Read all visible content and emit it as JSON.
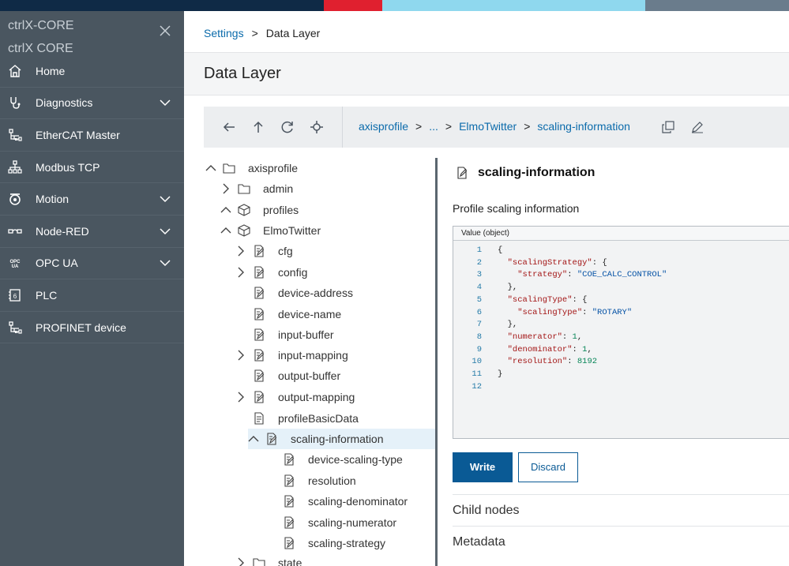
{
  "topbar": {
    "colors": [
      "#0f2a46",
      "#e0202f",
      "#8fd8ee",
      "#6a7c8c"
    ]
  },
  "sidebar": {
    "brand_line1": "ctrlX-CORE",
    "brand_line2": "ctrlX CORE",
    "items": [
      {
        "label": "Home",
        "icon": "home-icon",
        "has_chevron": false
      },
      {
        "label": "Diagnostics",
        "icon": "diagnostics-icon",
        "has_chevron": true
      },
      {
        "label": "EtherCAT Master",
        "icon": "network-icon",
        "has_chevron": false
      },
      {
        "label": "Modbus TCP",
        "icon": "sitemap-icon",
        "has_chevron": false
      },
      {
        "label": "Motion",
        "icon": "motion-icon",
        "has_chevron": true
      },
      {
        "label": "Node-RED",
        "icon": "node-red-icon",
        "has_chevron": true
      },
      {
        "label": "OPC UA",
        "icon": "opc-ua-icon",
        "has_chevron": true
      },
      {
        "label": "PLC",
        "icon": "plc-icon",
        "has_chevron": false
      },
      {
        "label": "PROFINET device",
        "icon": "network-icon",
        "has_chevron": false
      }
    ]
  },
  "breadcrumb": {
    "parent": "Settings",
    "sep": ">",
    "current": "Data Layer"
  },
  "page_title": "Data Layer",
  "path": {
    "root": "axisprofile",
    "ellipsis": "...",
    "parent": "ElmoTwitter",
    "current": "scaling-information",
    "sep": ">"
  },
  "tree": [
    {
      "label": "axisprofile",
      "depth": 0,
      "chevron": "up",
      "icon": "folder-icon"
    },
    {
      "label": "admin",
      "depth": 1,
      "chevron": "right",
      "icon": "folder-icon"
    },
    {
      "label": "profiles",
      "depth": 1,
      "chevron": "up",
      "icon": "cube-icon"
    },
    {
      "label": "ElmoTwitter",
      "depth": 2,
      "chevron": "up",
      "icon": "cube-icon"
    },
    {
      "label": "cfg",
      "depth": 3,
      "chevron": "right",
      "icon": "edit-doc-icon"
    },
    {
      "label": "config",
      "depth": 3,
      "chevron": "right",
      "icon": "edit-doc-icon"
    },
    {
      "label": "device-address",
      "depth": 3,
      "chevron": "",
      "icon": "edit-doc-icon"
    },
    {
      "label": "device-name",
      "depth": 3,
      "chevron": "",
      "icon": "edit-doc-icon"
    },
    {
      "label": "input-buffer",
      "depth": 3,
      "chevron": "",
      "icon": "edit-doc-icon"
    },
    {
      "label": "input-mapping",
      "depth": 3,
      "chevron": "right",
      "icon": "edit-doc-icon"
    },
    {
      "label": "output-buffer",
      "depth": 3,
      "chevron": "",
      "icon": "edit-doc-icon"
    },
    {
      "label": "output-mapping",
      "depth": 3,
      "chevron": "right",
      "icon": "edit-doc-icon"
    },
    {
      "label": "profileBasicData",
      "depth": 3,
      "chevron": "",
      "icon": "doc-icon"
    },
    {
      "label": "scaling-information",
      "depth": 3,
      "chevron": "up",
      "icon": "edit-doc-icon",
      "selected": true
    },
    {
      "label": "device-scaling-type",
      "depth": 4,
      "chevron": "",
      "icon": "edit-doc-icon"
    },
    {
      "label": "resolution",
      "depth": 4,
      "chevron": "",
      "icon": "edit-doc-icon"
    },
    {
      "label": "scaling-denominator",
      "depth": 4,
      "chevron": "",
      "icon": "edit-doc-icon"
    },
    {
      "label": "scaling-numerator",
      "depth": 4,
      "chevron": "",
      "icon": "edit-doc-icon"
    },
    {
      "label": "scaling-strategy",
      "depth": 4,
      "chevron": "",
      "icon": "edit-doc-icon"
    },
    {
      "label": "state",
      "depth": 3,
      "chevron": "right",
      "icon": "folder-icon"
    }
  ],
  "detail": {
    "title": "scaling-information",
    "description": "Profile scaling information",
    "editor_header": "Value (object)",
    "code": [
      [
        [
          "pun",
          "{"
        ]
      ],
      [
        [
          "pun",
          "  "
        ],
        [
          "key",
          "\"scalingStrategy\""
        ],
        [
          "pun",
          ": {"
        ]
      ],
      [
        [
          "pun",
          "    "
        ],
        [
          "key",
          "\"strategy\""
        ],
        [
          "pun",
          ": "
        ],
        [
          "str",
          "\"COE_CALC_CONTROL\""
        ]
      ],
      [
        [
          "pun",
          "  },"
        ]
      ],
      [
        [
          "pun",
          "  "
        ],
        [
          "key",
          "\"scalingType\""
        ],
        [
          "pun",
          ": {"
        ]
      ],
      [
        [
          "pun",
          "    "
        ],
        [
          "key",
          "\"scalingType\""
        ],
        [
          "pun",
          ": "
        ],
        [
          "str",
          "\"ROTARY\""
        ]
      ],
      [
        [
          "pun",
          "  },"
        ]
      ],
      [
        [
          "pun",
          "  "
        ],
        [
          "key",
          "\"numerator\""
        ],
        [
          "pun",
          ": "
        ],
        [
          "num",
          "1"
        ],
        [
          "pun",
          ","
        ]
      ],
      [
        [
          "pun",
          "  "
        ],
        [
          "key",
          "\"denominator\""
        ],
        [
          "pun",
          ": "
        ],
        [
          "num",
          "1"
        ],
        [
          "pun",
          ","
        ]
      ],
      [
        [
          "pun",
          "  "
        ],
        [
          "key",
          "\"resolution\""
        ],
        [
          "pun",
          ": "
        ],
        [
          "num",
          "8192"
        ]
      ],
      [
        [
          "pun",
          "}"
        ]
      ],
      [
        [
          "pun",
          ""
        ]
      ]
    ],
    "write_label": "Write",
    "discard_label": "Discard",
    "child_nodes_label": "Child nodes",
    "metadata_label": "Metadata"
  }
}
